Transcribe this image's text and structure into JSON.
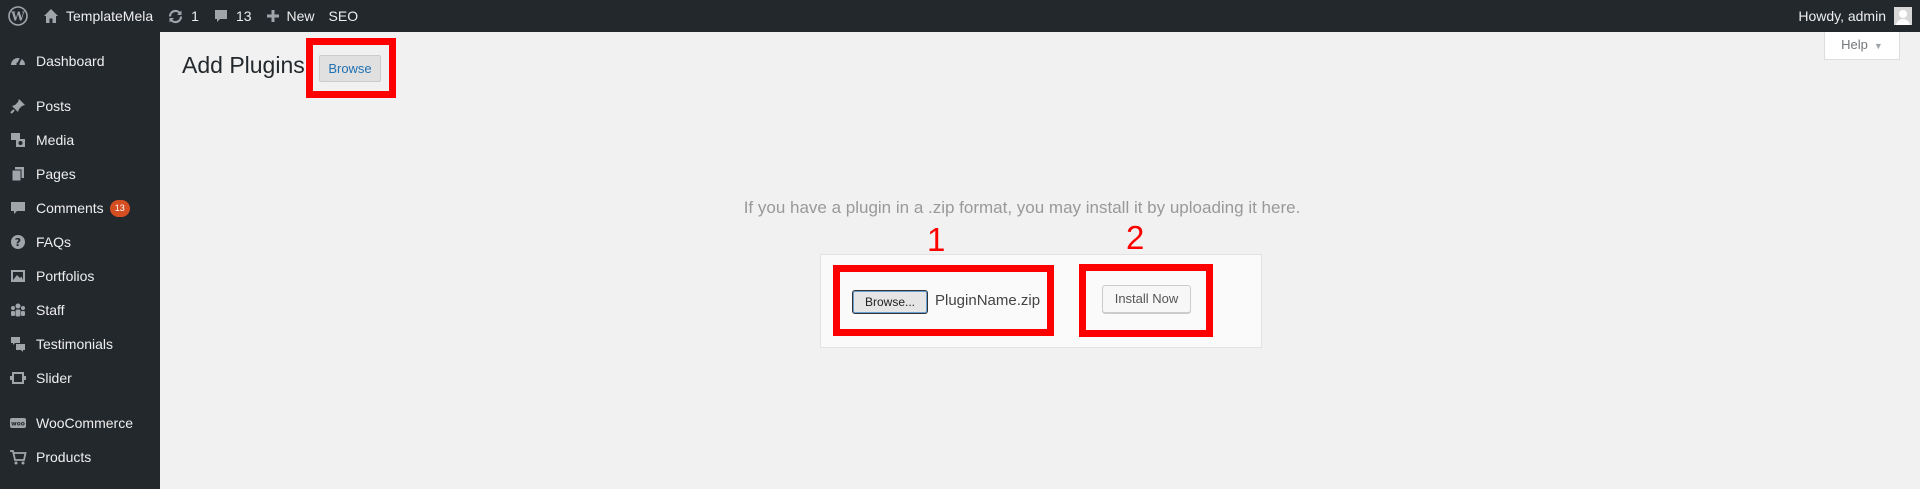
{
  "adminbar": {
    "site_name": "TemplateMela",
    "updates_count": "1",
    "comments_count": "13",
    "new_label": "New",
    "seo_label": "SEO",
    "greeting": "Howdy, admin"
  },
  "sidebar": {
    "items": [
      {
        "label": "Dashboard",
        "icon": "dashboard-icon"
      },
      {
        "label": "Posts",
        "icon": "pin-icon"
      },
      {
        "label": "Media",
        "icon": "media-icon"
      },
      {
        "label": "Pages",
        "icon": "pages-icon"
      },
      {
        "label": "Comments",
        "icon": "comment-icon",
        "badge": "13"
      },
      {
        "label": "FAQs",
        "icon": "help-icon"
      },
      {
        "label": "Portfolios",
        "icon": "portfolio-icon"
      },
      {
        "label": "Staff",
        "icon": "groups-icon"
      },
      {
        "label": "Testimonials",
        "icon": "testimonial-icon"
      },
      {
        "label": "Slider",
        "icon": "slides-icon"
      },
      {
        "label": "WooCommerce",
        "icon": "woo-icon"
      },
      {
        "label": "Products",
        "icon": "cart-icon"
      }
    ]
  },
  "main": {
    "title": "Add Plugins",
    "title_button": "Browse",
    "help_label": "Help",
    "upload_help": "If you have a plugin in a .zip format, you may install it by uploading it here.",
    "file_button": "Browse...",
    "file_name": "PluginName.zip",
    "install_button": "Install Now"
  },
  "annotations": {
    "step_1": "1",
    "step_2": "2",
    "color": "#ff0000"
  },
  "colors": {
    "adminbar_bg": "#23282d",
    "content_bg": "#f1f1f1",
    "badge": "#d54e21",
    "link": "#2271b1"
  }
}
